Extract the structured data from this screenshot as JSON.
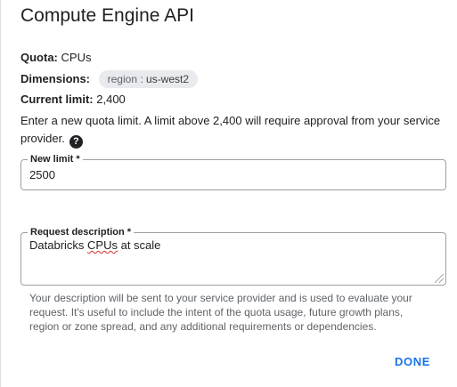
{
  "dialog": {
    "title": "Compute Engine API",
    "quota": {
      "label": "Quota:",
      "value": "CPUs"
    },
    "dimensions": {
      "label": "Dimensions:",
      "chip_key": "region :",
      "chip_value": "us-west2"
    },
    "current_limit": {
      "label": "Current limit:",
      "value": "2,400"
    },
    "info_text": "Enter a new quota limit. A limit above 2,400 will require approval from your service provider.",
    "help_icon": "help-icon",
    "new_limit": {
      "label": "New limit *",
      "value": "2500"
    },
    "request_description": {
      "label": "Request description *",
      "value_prefix": "Databricks ",
      "value_misspelled": "CPUs",
      "value_suffix": " at scale"
    },
    "hint_text": "Your description will be sent to your service provider and is used to evaluate your request. It's useful to include the intent of the quota usage, future growth plans, region or zone spread, and any additional requirements or dependencies.",
    "done_label": "DONE"
  },
  "colors": {
    "accent": "#1a73e8",
    "text": "#202124",
    "muted": "#5f6368",
    "chip_bg": "#e8eaed",
    "border": "#9aa0a6"
  }
}
